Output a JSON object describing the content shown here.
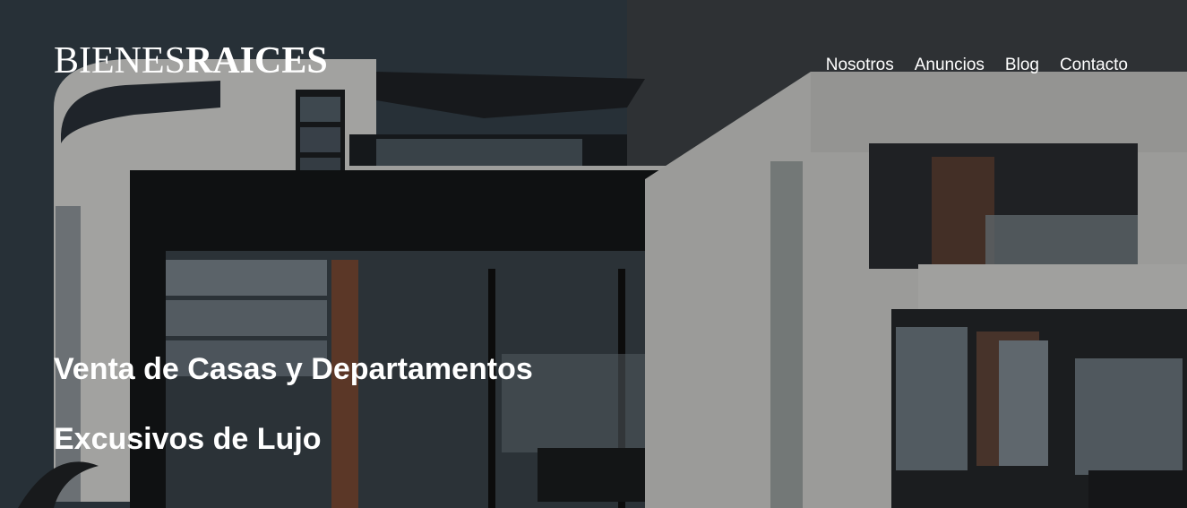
{
  "header": {
    "logo_light": "BIENES",
    "logo_bold": "RAICES",
    "nav": [
      {
        "label": "Nosotros"
      },
      {
        "label": "Anuncios"
      },
      {
        "label": "Blog"
      },
      {
        "label": "Contacto"
      }
    ]
  },
  "hero": {
    "heading_line1": "Venta de Casas y Departamentos",
    "heading_line2": "Excusivos de Lujo",
    "background": "modern-house-photo"
  },
  "colors": {
    "text": "#ffffff",
    "overlay": "#000000"
  }
}
